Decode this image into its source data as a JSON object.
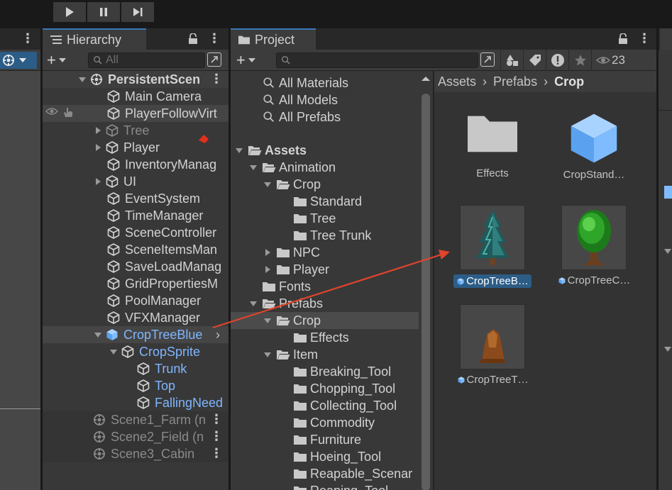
{
  "toolbar": {
    "play": "play-icon",
    "pause": "pause-icon",
    "step": "step-icon"
  },
  "hierarchy": {
    "tab_label": "Hierarchy",
    "search_placeholder": "All",
    "rows": [
      {
        "label": "PersistentScen",
        "kind": "scene"
      },
      {
        "label": "Main Camera",
        "kind": "cube"
      },
      {
        "label": "PlayerFollowVirt",
        "kind": "cube"
      },
      {
        "label": "Tree",
        "kind": "cube"
      },
      {
        "label": "Player",
        "kind": "cube"
      },
      {
        "label": "InventoryManag",
        "kind": "cube"
      },
      {
        "label": "UI",
        "kind": "cube"
      },
      {
        "label": "EventSystem",
        "kind": "cube"
      },
      {
        "label": "TimeManager",
        "kind": "cube"
      },
      {
        "label": "SceneController",
        "kind": "cube"
      },
      {
        "label": "SceneItemsMan",
        "kind": "cube"
      },
      {
        "label": "SaveLoadManag",
        "kind": "cube"
      },
      {
        "label": "GridPropertiesM",
        "kind": "cube"
      },
      {
        "label": "PoolManager",
        "kind": "cube"
      },
      {
        "label": "VFXManager",
        "kind": "cube"
      },
      {
        "label": "CropTreeBlue",
        "kind": "prefab"
      },
      {
        "label": "CropSprite",
        "kind": "prefab"
      },
      {
        "label": "Trunk",
        "kind": "prefab"
      },
      {
        "label": "Top",
        "kind": "prefab"
      },
      {
        "label": "FallingNeed",
        "kind": "prefab"
      },
      {
        "label": "Scene1_Farm (n",
        "kind": "scene"
      },
      {
        "label": "Scene2_Field (n",
        "kind": "scene"
      },
      {
        "label": "Scene3_Cabin",
        "kind": "scene"
      }
    ]
  },
  "project": {
    "tab_label": "Project",
    "hidden_count": "23",
    "favorites": [
      "All Materials",
      "All Models",
      "All Prefabs"
    ],
    "tree": [
      {
        "label": "Assets",
        "bold": true
      },
      {
        "label": "Animation"
      },
      {
        "label": "Crop"
      },
      {
        "label": "Standard"
      },
      {
        "label": "Tree"
      },
      {
        "label": "Tree Trunk"
      },
      {
        "label": "NPC"
      },
      {
        "label": "Player"
      },
      {
        "label": "Fonts"
      },
      {
        "label": "Prefabs"
      },
      {
        "label": "Crop"
      },
      {
        "label": "Effects"
      },
      {
        "label": "Item"
      },
      {
        "label": "Breaking_Tool"
      },
      {
        "label": "Chopping_Tool"
      },
      {
        "label": "Collecting_Tool"
      },
      {
        "label": "Commodity"
      },
      {
        "label": "Furniture"
      },
      {
        "label": "Hoeing_Tool"
      },
      {
        "label": "Reapable_Scenar"
      },
      {
        "label": "Reaping_Tool"
      }
    ],
    "breadcrumb": [
      "Assets",
      "Prefabs",
      "Crop"
    ],
    "items": [
      {
        "label": "Effects",
        "type": "folder"
      },
      {
        "label": "CropStand…",
        "type": "prefab-large"
      },
      {
        "label": "CropTreeB…",
        "type": "prefab-blue-tree",
        "selected": true
      },
      {
        "label": "CropTreeC…",
        "type": "prefab-green-tree"
      },
      {
        "label": "CropTreeT…",
        "type": "prefab-stump"
      }
    ]
  },
  "colors": {
    "accent_blue": "#7fb6ff",
    "selection": "#2c5d87",
    "arrow_red": "#e0442c"
  }
}
